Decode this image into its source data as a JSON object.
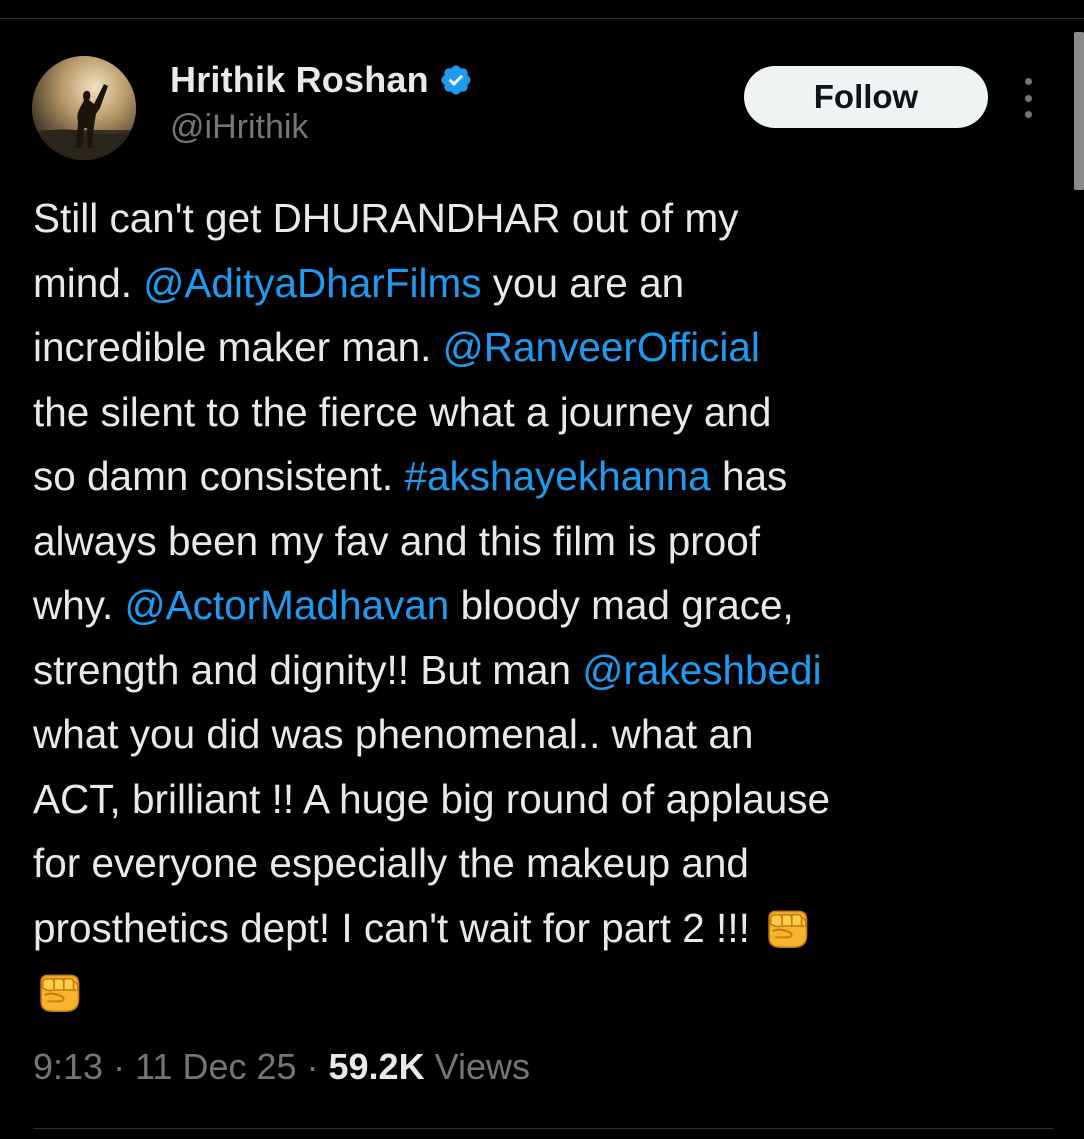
{
  "author": {
    "display_name": "Hrithik Roshan",
    "handle": "@iHrithik",
    "verified": true
  },
  "follow_label": "Follow",
  "tweet_lines": [
    [
      {
        "t": "Still can't get DHURANDHAR out of my"
      }
    ],
    [
      {
        "t": "mind. "
      },
      {
        "t": "@AdityaDharFilms",
        "m": true
      },
      {
        "t": " you are an"
      }
    ],
    [
      {
        "t": "incredible maker man. "
      },
      {
        "t": "@RanveerOfficial",
        "m": true
      }
    ],
    [
      {
        "t": "the silent to the fierce what a journey and"
      }
    ],
    [
      {
        "t": "so damn consistent. "
      },
      {
        "t": "#akshayekhanna",
        "m": true
      },
      {
        "t": " has"
      }
    ],
    [
      {
        "t": "always been my fav and this film is proof"
      }
    ],
    [
      {
        "t": "why. "
      },
      {
        "t": "@ActorMadhavan",
        "m": true
      },
      {
        "t": " bloody mad grace,"
      }
    ],
    [
      {
        "t": "strength and dignity!! But man "
      },
      {
        "t": "@rakeshbedi",
        "m": true
      }
    ],
    [
      {
        "t": "what you did was phenomenal.. what an"
      }
    ],
    [
      {
        "t": "ACT, brilliant !! A huge big round of applause"
      }
    ],
    [
      {
        "t": "for everyone especially the makeup and"
      }
    ],
    [
      {
        "t": "prosthetics dept! I can't wait for part 2 !!! "
      },
      {
        "e": "oncoming-fist-icon"
      }
    ],
    [
      {
        "e": "oncoming-fist-icon"
      }
    ]
  ],
  "meta": {
    "time": "9:13",
    "separator": " · ",
    "date": "11 Dec 25",
    "views_count": "59.2K",
    "views_label": " Views"
  },
  "colors": {
    "background": "#000000",
    "text": "#e7e9ea",
    "secondary": "#71767b",
    "link": "#1d9bf0",
    "verified": "#1d9bf0"
  }
}
